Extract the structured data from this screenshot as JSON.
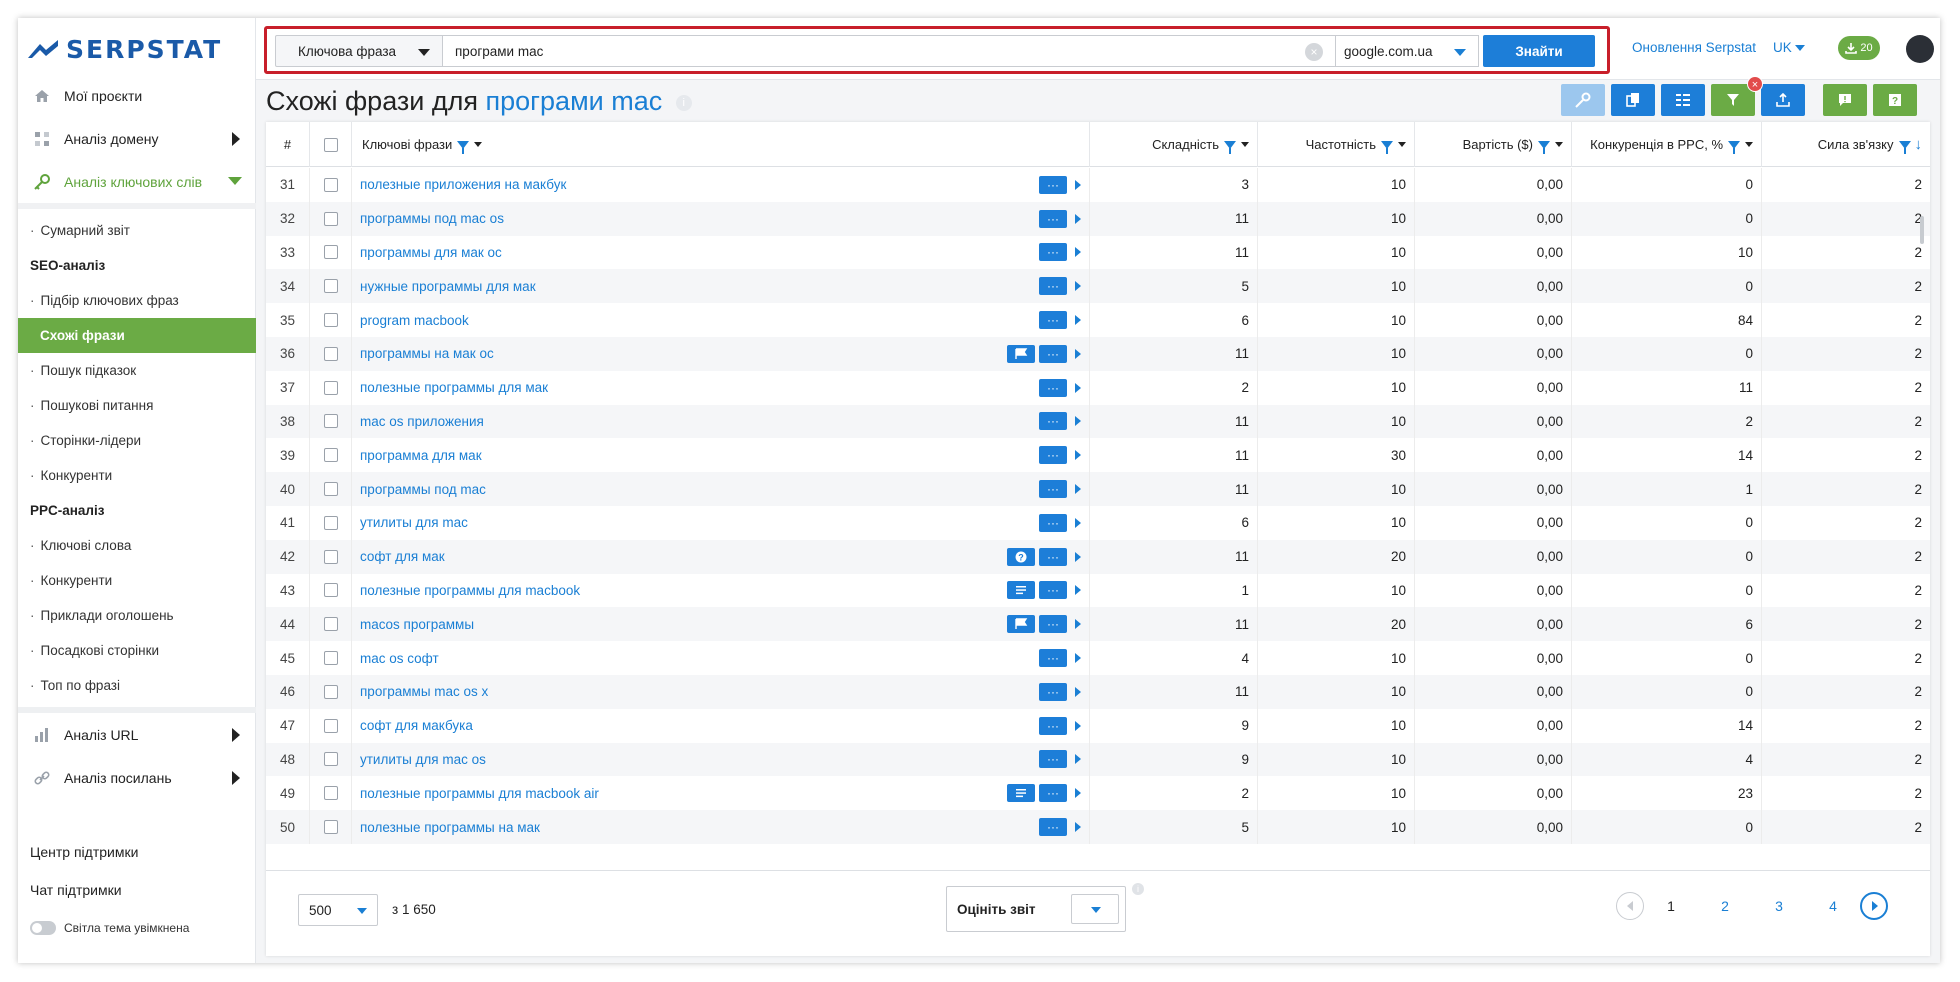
{
  "brand": {
    "name": "SERPSTAT"
  },
  "sidebar": {
    "main": [
      {
        "label": "Мої проєкти",
        "icon": "home-icon"
      },
      {
        "label": "Аналіз домену",
        "icon": "domain-icon"
      },
      {
        "label": "Аналіз ключових слів",
        "icon": "key-icon"
      }
    ],
    "sub": [
      {
        "type": "item",
        "label": "Сумарний звіт"
      },
      {
        "type": "head",
        "label": "SEO-аналіз"
      },
      {
        "type": "item",
        "label": "Підбір ключових фраз"
      },
      {
        "type": "selected",
        "label": "Схожі фрази"
      },
      {
        "type": "item",
        "label": "Пошук підказок"
      },
      {
        "type": "item",
        "label": "Пошукові питання"
      },
      {
        "type": "item",
        "label": "Сторінки-лідери"
      },
      {
        "type": "item",
        "label": "Конкуренти"
      },
      {
        "type": "head",
        "label": "PPC-аналіз"
      },
      {
        "type": "item",
        "label": "Ключові слова"
      },
      {
        "type": "item",
        "label": "Конкуренти"
      },
      {
        "type": "item",
        "label": "Приклади оголошень"
      },
      {
        "type": "item",
        "label": "Посадкові сторінки"
      },
      {
        "type": "item",
        "label": "Топ по фразі"
      }
    ],
    "lower": [
      {
        "label": "Аналіз URL",
        "icon": "bar-chart-icon"
      },
      {
        "label": "Аналіз посилань",
        "icon": "link-icon"
      }
    ],
    "support": [
      "Центр підтримки",
      "Чат підтримки"
    ],
    "theme_toggle": "Світла тема увімкнена"
  },
  "header": {
    "search_type": "Ключова фраза",
    "query": "програми mac",
    "engine": "google.com.ua",
    "search_button": "Знайти",
    "updates_link": "Оновлення Serpstat",
    "lang": "UK",
    "downloads": "20"
  },
  "page": {
    "title_prefix": "Схожі фрази для",
    "title_keyword": "програми mac"
  },
  "table": {
    "headers": {
      "num": "#",
      "keyword": "Ключові фрази",
      "difficulty": "Складність",
      "volume": "Частотність",
      "cost": "Вартість ($)",
      "competition": "Конкуренція в PPC, %",
      "strength": "Сила зв'язку"
    },
    "rows": [
      {
        "n": "31",
        "kw": "полезные приложения на макбук",
        "feature": "",
        "d": "3",
        "v": "10",
        "c": "0,00",
        "p": "0",
        "s": "2"
      },
      {
        "n": "32",
        "kw": "программы под mac os",
        "feature": "",
        "d": "11",
        "v": "10",
        "c": "0,00",
        "p": "0",
        "s": "2"
      },
      {
        "n": "33",
        "kw": "программы для мак ос",
        "feature": "",
        "d": "11",
        "v": "10",
        "c": "0,00",
        "p": "10",
        "s": "2"
      },
      {
        "n": "34",
        "kw": "нужные программы для мак",
        "feature": "",
        "d": "5",
        "v": "10",
        "c": "0,00",
        "p": "0",
        "s": "2"
      },
      {
        "n": "35",
        "kw": "program macbook",
        "feature": "",
        "d": "6",
        "v": "10",
        "c": "0,00",
        "p": "84",
        "s": "2"
      },
      {
        "n": "36",
        "kw": "программы на мак ос",
        "feature": "flag",
        "d": "11",
        "v": "10",
        "c": "0,00",
        "p": "0",
        "s": "2"
      },
      {
        "n": "37",
        "kw": "полезные программы для мак",
        "feature": "",
        "d": "2",
        "v": "10",
        "c": "0,00",
        "p": "11",
        "s": "2"
      },
      {
        "n": "38",
        "kw": "mac os приложения",
        "feature": "",
        "d": "11",
        "v": "10",
        "c": "0,00",
        "p": "2",
        "s": "2"
      },
      {
        "n": "39",
        "kw": "программа для мак",
        "feature": "",
        "d": "11",
        "v": "30",
        "c": "0,00",
        "p": "14",
        "s": "2"
      },
      {
        "n": "40",
        "kw": "программы под mac",
        "feature": "",
        "d": "11",
        "v": "10",
        "c": "0,00",
        "p": "1",
        "s": "2"
      },
      {
        "n": "41",
        "kw": "утилиты для mac",
        "feature": "",
        "d": "6",
        "v": "10",
        "c": "0,00",
        "p": "0",
        "s": "2"
      },
      {
        "n": "42",
        "kw": "софт для мак",
        "feature": "question",
        "d": "11",
        "v": "20",
        "c": "0,00",
        "p": "0",
        "s": "2"
      },
      {
        "n": "43",
        "kw": "полезные программы для macbook",
        "feature": "list",
        "d": "1",
        "v": "10",
        "c": "0,00",
        "p": "0",
        "s": "2"
      },
      {
        "n": "44",
        "kw": "macos программы",
        "feature": "flag",
        "d": "11",
        "v": "20",
        "c": "0,00",
        "p": "6",
        "s": "2"
      },
      {
        "n": "45",
        "kw": "mac os софт",
        "feature": "",
        "d": "4",
        "v": "10",
        "c": "0,00",
        "p": "0",
        "s": "2"
      },
      {
        "n": "46",
        "kw": "программы mac os x",
        "feature": "",
        "d": "11",
        "v": "10",
        "c": "0,00",
        "p": "0",
        "s": "2"
      },
      {
        "n": "47",
        "kw": "софт для макбука",
        "feature": "",
        "d": "9",
        "v": "10",
        "c": "0,00",
        "p": "14",
        "s": "2"
      },
      {
        "n": "48",
        "kw": "утилиты для mac os",
        "feature": "",
        "d": "9",
        "v": "10",
        "c": "0,00",
        "p": "4",
        "s": "2"
      },
      {
        "n": "49",
        "kw": "полезные программы для macbook air",
        "feature": "list",
        "d": "2",
        "v": "10",
        "c": "0,00",
        "p": "23",
        "s": "2"
      },
      {
        "n": "50",
        "kw": "полезные программы на мак",
        "feature": "",
        "d": "5",
        "v": "10",
        "c": "0,00",
        "p": "0",
        "s": "2"
      }
    ]
  },
  "footer": {
    "per_page": "500",
    "total": "з 1 650",
    "rate_label": "Оцініть звіт",
    "pages": [
      "1",
      "2",
      "3",
      "4"
    ],
    "current_page": "1"
  },
  "colors": {
    "brand": "#1a5aa8",
    "accent": "#1d7ed8",
    "green": "#6bab45",
    "highlight": "#c81f2a"
  }
}
